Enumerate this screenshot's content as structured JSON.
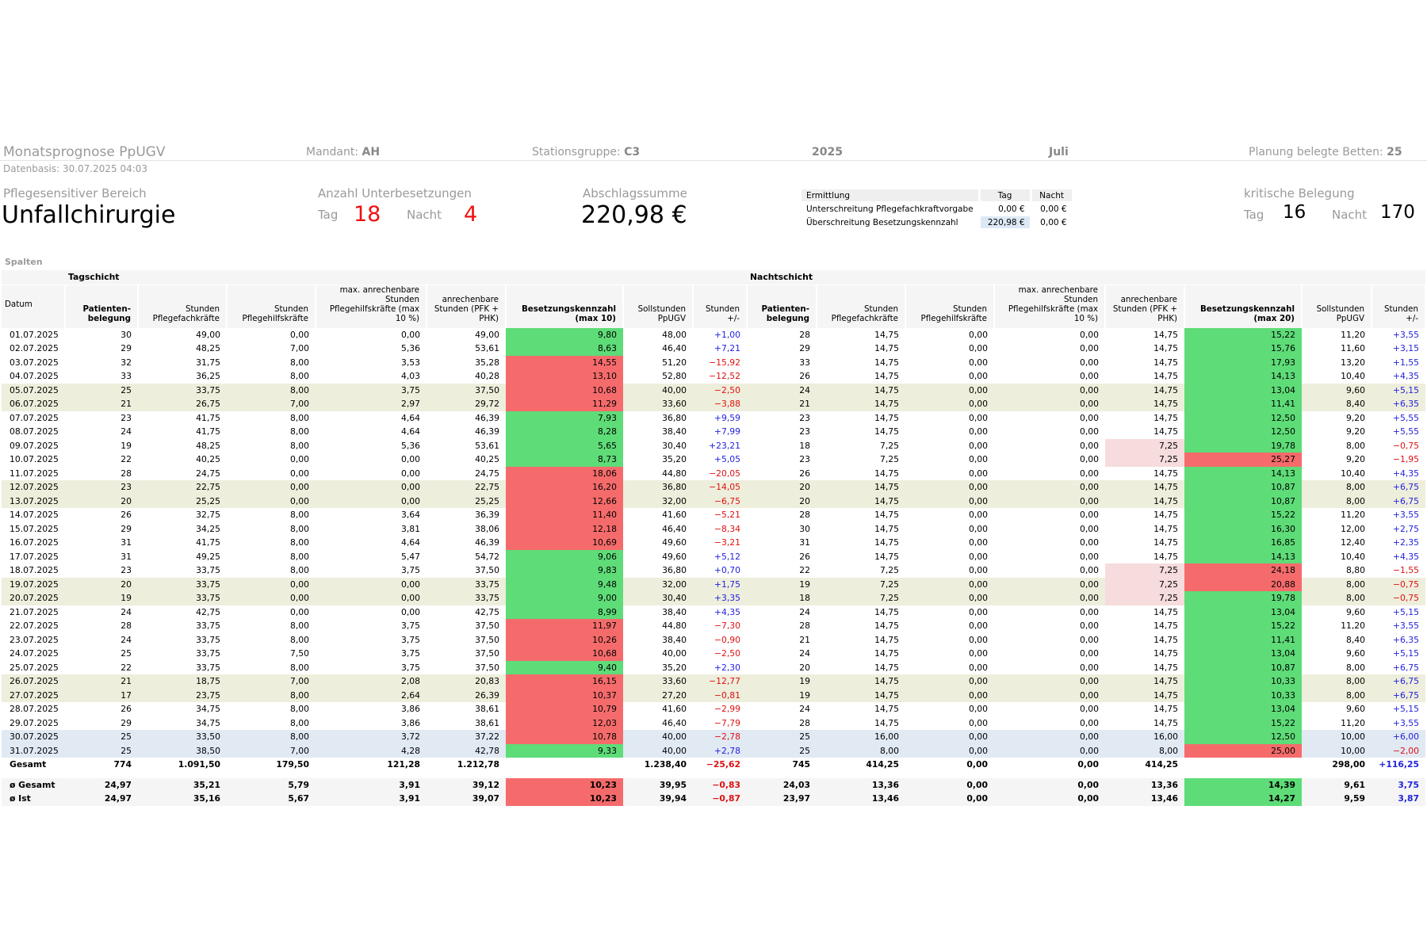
{
  "header": {
    "title": "Monatsprognose PpUGV",
    "mandant_label": "Mandant:",
    "mandant_value": "AH",
    "stationsgruppe_label": "Stationsgruppe:",
    "stationsgruppe_value": "C3",
    "year": "2025",
    "month": "Juli",
    "planung_label": "Planung belegte Betten:",
    "planung_value": "25",
    "datenbasis": "Datenbasis: 30.07.2025 04:03"
  },
  "kpis": {
    "bereich_label": "Pflegesensitiver Bereich",
    "bereich_value": "Unfallchirurgie",
    "unter_label": "Anzahl Unterbesetzungen",
    "tag_label": "Tag",
    "nacht_label": "Nacht",
    "unter_tag": "18",
    "unter_nacht": "4",
    "abschlag_label": "Abschlagssumme",
    "abschlag_value": "220,98 €",
    "kritisch_label": "kritische Belegung",
    "kritisch_tag": "16",
    "kritisch_nacht": "170"
  },
  "ermittlung": {
    "headers": [
      "Ermittlung",
      "Tag",
      "Nacht"
    ],
    "rows": [
      [
        "Unterschreitung Pflegefachkraftvorgabe",
        "0,00 €",
        "0,00 €"
      ],
      [
        "Überschreitung Besetzungskennzahl",
        "220,98 €",
        "0,00 €"
      ]
    ]
  },
  "spalten_label": "Spalten",
  "table": {
    "group_day": "Tagschicht",
    "group_night": "Nachtschicht",
    "headers": [
      "Datum",
      "Patienten-belegung",
      "Stunden Pflegefachkräfte",
      "Stunden Pflegehilfskräfte",
      "max. anrechenbare Stunden Pflegehilfskräfte (max 10 %)",
      "anrechenbare Stunden (PFK + PHK)",
      "Besetzungskennzahl (max 10)",
      "Sollstunden PpUGV",
      "Stunden +/-",
      "Patienten-belegung",
      "Stunden Pflegefachkräfte",
      "Stunden Pflegehilfskräfte",
      "max. anrechenbare Stunden Pflegehilfskräfte (max 10 %)",
      "anrechenbare Stunden (PFK + PHK)",
      "Besetzungskennzahl (max 20)",
      "Sollstunden PpUGV",
      "Stunden +/-"
    ],
    "rows": [
      [
        "01.07.2025",
        "30",
        "49,00",
        "0,00",
        "0,00",
        "49,00",
        "9,80",
        "48,00",
        "+1,00",
        "28",
        "14,75",
        "0,00",
        "0,00",
        "14,75",
        "15,22",
        "11,20",
        "+3,55"
      ],
      [
        "02.07.2025",
        "29",
        "48,25",
        "7,00",
        "5,36",
        "53,61",
        "8,63",
        "46,40",
        "+7,21",
        "29",
        "14,75",
        "0,00",
        "0,00",
        "14,75",
        "15,76",
        "11,60",
        "+3,15"
      ],
      [
        "03.07.2025",
        "32",
        "31,75",
        "8,00",
        "3,53",
        "35,28",
        "14,55",
        "51,20",
        "−15,92",
        "33",
        "14,75",
        "0,00",
        "0,00",
        "14,75",
        "17,93",
        "13,20",
        "+1,55"
      ],
      [
        "04.07.2025",
        "33",
        "36,25",
        "8,00",
        "4,03",
        "40,28",
        "13,10",
        "52,80",
        "−12,52",
        "26",
        "14,75",
        "0,00",
        "0,00",
        "14,75",
        "14,13",
        "10,40",
        "+4,35"
      ],
      [
        "05.07.2025",
        "25",
        "33,75",
        "8,00",
        "3,75",
        "37,50",
        "10,68",
        "40,00",
        "−2,50",
        "24",
        "14,75",
        "0,00",
        "0,00",
        "14,75",
        "13,04",
        "9,60",
        "+5,15"
      ],
      [
        "06.07.2025",
        "21",
        "26,75",
        "7,00",
        "2,97",
        "29,72",
        "11,29",
        "33,60",
        "−3,88",
        "21",
        "14,75",
        "0,00",
        "0,00",
        "14,75",
        "11,41",
        "8,40",
        "+6,35"
      ],
      [
        "07.07.2025",
        "23",
        "41,75",
        "8,00",
        "4,64",
        "46,39",
        "7,93",
        "36,80",
        "+9,59",
        "23",
        "14,75",
        "0,00",
        "0,00",
        "14,75",
        "12,50",
        "9,20",
        "+5,55"
      ],
      [
        "08.07.2025",
        "24",
        "41,75",
        "8,00",
        "4,64",
        "46,39",
        "8,28",
        "38,40",
        "+7,99",
        "23",
        "14,75",
        "0,00",
        "0,00",
        "14,75",
        "12,50",
        "9,20",
        "+5,55"
      ],
      [
        "09.07.2025",
        "19",
        "48,25",
        "8,00",
        "5,36",
        "53,61",
        "5,65",
        "30,40",
        "+23,21",
        "18",
        "7,25",
        "0,00",
        "0,00",
        "7,25",
        "19,78",
        "8,00",
        "−0,75"
      ],
      [
        "10.07.2025",
        "22",
        "40,25",
        "0,00",
        "0,00",
        "40,25",
        "8,73",
        "35,20",
        "+5,05",
        "23",
        "7,25",
        "0,00",
        "0,00",
        "7,25",
        "25,27",
        "9,20",
        "−1,95"
      ],
      [
        "11.07.2025",
        "28",
        "24,75",
        "0,00",
        "0,00",
        "24,75",
        "18,06",
        "44,80",
        "−20,05",
        "26",
        "14,75",
        "0,00",
        "0,00",
        "14,75",
        "14,13",
        "10,40",
        "+4,35"
      ],
      [
        "12.07.2025",
        "23",
        "22,75",
        "0,00",
        "0,00",
        "22,75",
        "16,20",
        "36,80",
        "−14,05",
        "20",
        "14,75",
        "0,00",
        "0,00",
        "14,75",
        "10,87",
        "8,00",
        "+6,75"
      ],
      [
        "13.07.2025",
        "20",
        "25,25",
        "0,00",
        "0,00",
        "25,25",
        "12,66",
        "32,00",
        "−6,75",
        "20",
        "14,75",
        "0,00",
        "0,00",
        "14,75",
        "10,87",
        "8,00",
        "+6,75"
      ],
      [
        "14.07.2025",
        "26",
        "32,75",
        "8,00",
        "3,64",
        "36,39",
        "11,40",
        "41,60",
        "−5,21",
        "28",
        "14,75",
        "0,00",
        "0,00",
        "14,75",
        "15,22",
        "11,20",
        "+3,55"
      ],
      [
        "15.07.2025",
        "29",
        "34,25",
        "8,00",
        "3,81",
        "38,06",
        "12,18",
        "46,40",
        "−8,34",
        "30",
        "14,75",
        "0,00",
        "0,00",
        "14,75",
        "16,30",
        "12,00",
        "+2,75"
      ],
      [
        "16.07.2025",
        "31",
        "41,75",
        "8,00",
        "4,64",
        "46,39",
        "10,69",
        "49,60",
        "−3,21",
        "31",
        "14,75",
        "0,00",
        "0,00",
        "14,75",
        "16,85",
        "12,40",
        "+2,35"
      ],
      [
        "17.07.2025",
        "31",
        "49,25",
        "8,00",
        "5,47",
        "54,72",
        "9,06",
        "49,60",
        "+5,12",
        "26",
        "14,75",
        "0,00",
        "0,00",
        "14,75",
        "14,13",
        "10,40",
        "+4,35"
      ],
      [
        "18.07.2025",
        "23",
        "33,75",
        "8,00",
        "3,75",
        "37,50",
        "9,83",
        "36,80",
        "+0,70",
        "22",
        "7,25",
        "0,00",
        "0,00",
        "7,25",
        "24,18",
        "8,80",
        "−1,55"
      ],
      [
        "19.07.2025",
        "20",
        "33,75",
        "0,00",
        "0,00",
        "33,75",
        "9,48",
        "32,00",
        "+1,75",
        "19",
        "7,25",
        "0,00",
        "0,00",
        "7,25",
        "20,88",
        "8,00",
        "−0,75"
      ],
      [
        "20.07.2025",
        "19",
        "33,75",
        "0,00",
        "0,00",
        "33,75",
        "9,00",
        "30,40",
        "+3,35",
        "18",
        "7,25",
        "0,00",
        "0,00",
        "7,25",
        "19,78",
        "8,00",
        "−0,75"
      ],
      [
        "21.07.2025",
        "24",
        "42,75",
        "0,00",
        "0,00",
        "42,75",
        "8,99",
        "38,40",
        "+4,35",
        "24",
        "14,75",
        "0,00",
        "0,00",
        "14,75",
        "13,04",
        "9,60",
        "+5,15"
      ],
      [
        "22.07.2025",
        "28",
        "33,75",
        "8,00",
        "3,75",
        "37,50",
        "11,97",
        "44,80",
        "−7,30",
        "28",
        "14,75",
        "0,00",
        "0,00",
        "14,75",
        "15,22",
        "11,20",
        "+3,55"
      ],
      [
        "23.07.2025",
        "24",
        "33,75",
        "8,00",
        "3,75",
        "37,50",
        "10,26",
        "38,40",
        "−0,90",
        "21",
        "14,75",
        "0,00",
        "0,00",
        "14,75",
        "11,41",
        "8,40",
        "+6,35"
      ],
      [
        "24.07.2025",
        "25",
        "33,75",
        "7,50",
        "3,75",
        "37,50",
        "10,68",
        "40,00",
        "−2,50",
        "24",
        "14,75",
        "0,00",
        "0,00",
        "14,75",
        "13,04",
        "9,60",
        "+5,15"
      ],
      [
        "25.07.2025",
        "22",
        "33,75",
        "8,00",
        "3,75",
        "37,50",
        "9,40",
        "35,20",
        "+2,30",
        "20",
        "14,75",
        "0,00",
        "0,00",
        "14,75",
        "10,87",
        "8,00",
        "+6,75"
      ],
      [
        "26.07.2025",
        "21",
        "18,75",
        "7,00",
        "2,08",
        "20,83",
        "16,15",
        "33,60",
        "−12,77",
        "19",
        "14,75",
        "0,00",
        "0,00",
        "14,75",
        "10,33",
        "8,00",
        "+6,75"
      ],
      [
        "27.07.2025",
        "17",
        "23,75",
        "8,00",
        "2,64",
        "26,39",
        "10,37",
        "27,20",
        "−0,81",
        "19",
        "14,75",
        "0,00",
        "0,00",
        "14,75",
        "10,33",
        "8,00",
        "+6,75"
      ],
      [
        "28.07.2025",
        "26",
        "34,75",
        "8,00",
        "3,86",
        "38,61",
        "10,79",
        "41,60",
        "−2,99",
        "24",
        "14,75",
        "0,00",
        "0,00",
        "14,75",
        "13,04",
        "9,60",
        "+5,15"
      ],
      [
        "29.07.2025",
        "29",
        "34,75",
        "8,00",
        "3,86",
        "38,61",
        "12,03",
        "46,40",
        "−7,79",
        "28",
        "14,75",
        "0,00",
        "0,00",
        "14,75",
        "15,22",
        "11,20",
        "+3,55"
      ],
      [
        "30.07.2025",
        "25",
        "33,50",
        "8,00",
        "3,72",
        "37,22",
        "10,78",
        "40,00",
        "−2,78",
        "25",
        "16,00",
        "0,00",
        "0,00",
        "16,00",
        "12,50",
        "10,00",
        "+6,00"
      ],
      [
        "31.07.2025",
        "25",
        "38,50",
        "7,00",
        "4,28",
        "42,78",
        "9,33",
        "40,00",
        "+2,78",
        "25",
        "8,00",
        "0,00",
        "0,00",
        "8,00",
        "25,00",
        "10,00",
        "−2,00"
      ]
    ],
    "row_types": [
      "",
      "",
      "",
      "",
      "we",
      "we",
      "",
      "",
      "",
      "",
      "",
      "we",
      "we",
      "",
      "",
      "",
      "",
      "",
      "we",
      "we",
      "",
      "",
      "",
      "",
      "",
      "we",
      "we",
      "",
      "",
      "fc",
      "fc"
    ],
    "day_bk_colors": [
      "green",
      "green",
      "red",
      "red",
      "red",
      "red",
      "green",
      "green",
      "green",
      "green",
      "red",
      "red",
      "red",
      "red",
      "red",
      "red",
      "green",
      "green",
      "green",
      "green",
      "green",
      "red",
      "red",
      "red",
      "green",
      "red",
      "red",
      "red",
      "red",
      "red",
      "green"
    ],
    "night_bk_colors": [
      "green",
      "green",
      "green",
      "green",
      "green",
      "green",
      "green",
      "green",
      "green",
      "red",
      "green",
      "green",
      "green",
      "green",
      "green",
      "green",
      "green",
      "red",
      "red",
      "green",
      "green",
      "green",
      "green",
      "green",
      "green",
      "green",
      "green",
      "green",
      "green",
      "green",
      "red"
    ],
    "night_anr_pink": [
      false,
      false,
      false,
      false,
      false,
      false,
      false,
      false,
      true,
      true,
      false,
      false,
      false,
      false,
      false,
      false,
      false,
      true,
      true,
      true,
      false,
      false,
      false,
      false,
      false,
      false,
      false,
      false,
      false,
      false,
      false
    ],
    "total": [
      "Gesamt",
      "774",
      "1.091,50",
      "179,50",
      "121,28",
      "1.212,78",
      "",
      "1.238,40",
      "−25,62",
      "745",
      "414,25",
      "0,00",
      "0,00",
      "414,25",
      "",
      "298,00",
      "+116,25"
    ],
    "avg_rows": [
      [
        "ø Gesamt",
        "24,97",
        "35,21",
        "5,79",
        "3,91",
        "39,12",
        "10,23",
        "39,95",
        "−0,83",
        "24,03",
        "13,36",
        "0,00",
        "0,00",
        "13,36",
        "14,39",
        "9,61",
        "3,75"
      ],
      [
        "ø Ist",
        "24,97",
        "35,16",
        "5,67",
        "3,91",
        "39,07",
        "10,23",
        "39,94",
        "−0,87",
        "23,97",
        "13,46",
        "0,00",
        "0,00",
        "13,46",
        "14,27",
        "9,59",
        "3,87"
      ]
    ],
    "avg_day_bk_colors": [
      "red",
      "red"
    ],
    "avg_night_bk_colors": [
      "green",
      "green"
    ]
  }
}
